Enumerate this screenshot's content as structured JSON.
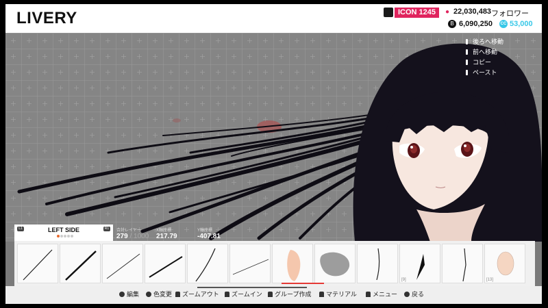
{
  "header": {
    "title": "LIVERY",
    "icon_label": "ICON 1245",
    "followers": "22,030,483",
    "followers_label": "フォロワー",
    "coins": "6,090,250",
    "cc_credits": "53,000",
    "colors": {
      "icon_badge": "#e0245e",
      "cc": "#38c8e8"
    }
  },
  "context_menu": [
    {
      "label": "後ろへ移動"
    },
    {
      "label": "前へ移動"
    },
    {
      "label": "コピー"
    },
    {
      "label": "ペースト"
    }
  ],
  "side_panel": {
    "name": "LEFT SIDE",
    "left_button": "L1",
    "right_button": "R1",
    "page_count": 5,
    "active_page": 1
  },
  "stats": {
    "layers_label": "合計レイヤー",
    "layers_value": "279",
    "layers_max": "/ 1000",
    "x_label": "X軸座標",
    "x_value": "217.79",
    "y_label": "Y軸座標",
    "y_value": "-407.81"
  },
  "thumbnails": [
    {
      "kind": "stroke-thin"
    },
    {
      "kind": "stroke-thick"
    },
    {
      "kind": "stroke-thin"
    },
    {
      "kind": "stroke-thick"
    },
    {
      "kind": "stroke-curve"
    },
    {
      "kind": "stroke-flat"
    },
    {
      "kind": "skin-shape",
      "selected": true
    },
    {
      "kind": "grey-blob"
    },
    {
      "kind": "stroke-curve"
    },
    {
      "kind": "stroke-dark",
      "label": "[9]"
    },
    {
      "kind": "stroke-vertical"
    },
    {
      "kind": "skin-oval",
      "label": "[13]"
    }
  ],
  "footer": {
    "edit": "編集",
    "color": "色変更",
    "zoom_out": "ズームアウト",
    "zoom_in": "ズームイン",
    "group": "グループ作成",
    "material": "マテリアル",
    "menu": "メニュー",
    "back": "戻る"
  }
}
